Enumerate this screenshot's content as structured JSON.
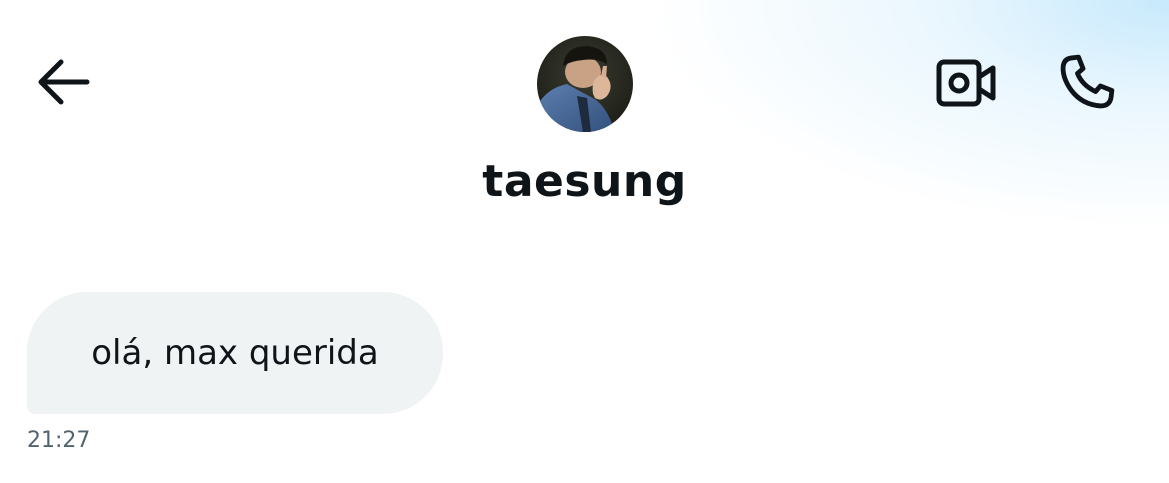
{
  "header": {
    "back_icon": "arrow-left-icon",
    "avatar": "contact-avatar",
    "contact_name": "taesung",
    "video_icon": "video-camera-icon",
    "call_icon": "phone-icon"
  },
  "messages": [
    {
      "direction": "incoming",
      "text": "olá, max querida",
      "time": "21:27"
    }
  ],
  "colors": {
    "text_primary": "#0f1419",
    "text_secondary": "#536471",
    "bubble_incoming": "#eff3f4",
    "header_gradient": "#c4e8fc"
  }
}
